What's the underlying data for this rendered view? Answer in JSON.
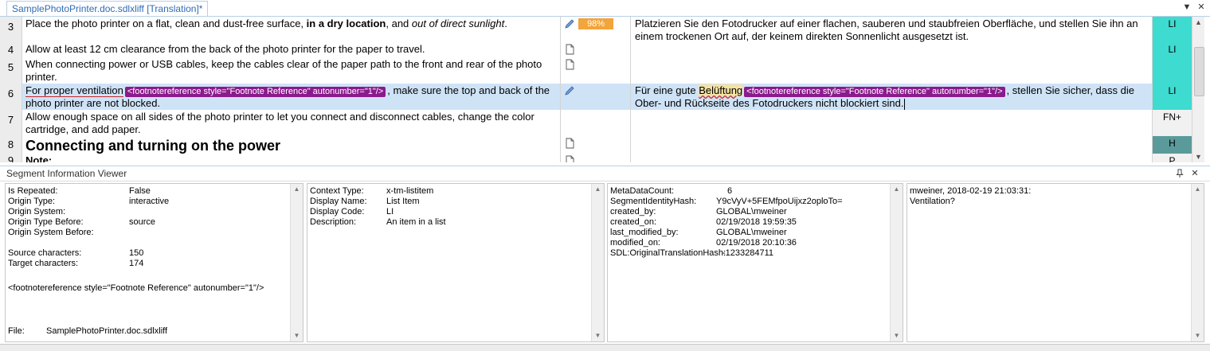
{
  "tab": {
    "title": "SamplePhotoPrinter.doc.sdlxliff [Translation]*"
  },
  "window_buttons": {
    "dropdown": "▼",
    "close": "✕"
  },
  "editor": {
    "rows": [
      {
        "num": "3",
        "status": "98%",
        "style": "LI",
        "src_parts": [
          "Place the photo printer on a flat, clean and dust-free surface, ",
          "in a dry location",
          ", and ",
          "out of direct sunlight",
          "."
        ],
        "tgt": "Platzieren Sie den Fotodrucker auf einer flachen, sauberen und staubfreien Oberfläche, und stellen Sie ihn an einem trockenen Ort auf, der keinem direkten Sonnenlicht ausgesetzt ist."
      },
      {
        "num": "4",
        "style": "LI",
        "src": "Allow at least 12 cm clearance from the back of the photo printer for the paper to travel.",
        "tgt": ""
      },
      {
        "num": "5",
        "style": "",
        "src": "When connecting power or USB cables, keep the cables clear of the paper path to the front and rear of the photo printer.",
        "tgt": ""
      },
      {
        "num": "6",
        "style": "LI",
        "src_a": "For proper ventilation",
        "tag": "<footnotereference style=\"Footnote Reference\" autonumber=\"1\"/>",
        "src_b": ", make sure the top and back of the photo printer are not blocked.",
        "tgt_a": "Für eine gute ",
        "tgt_hl": "Belüftung",
        "tgt_b": ", stellen Sie sicher, dass die Ober- und Rückseite des Fotodruckers nicht blockiert sind."
      },
      {
        "num": "7",
        "style": "FN+",
        "src": "Allow enough space on all sides of the photo printer to let you connect and disconnect cables, change the color cartridge, and add paper.",
        "tgt": ""
      },
      {
        "num": "8",
        "style": "H",
        "src": "Connecting and turning on the power",
        "tgt": ""
      },
      {
        "num": "9",
        "style": "P",
        "src": "Note:",
        "tgt": ""
      }
    ]
  },
  "viewer": {
    "title": "Segment Information Viewer",
    "pane1": {
      "rows": [
        {
          "k": "Is Repeated:",
          "v": "False"
        },
        {
          "k": "Origin Type:",
          "v": "interactive"
        },
        {
          "k": "Origin System:",
          "v": ""
        },
        {
          "k": "Origin Type Before:",
          "v": "source"
        },
        {
          "k": "Origin System Before:",
          "v": ""
        }
      ],
      "chars": [
        {
          "k": "Source characters:",
          "v": "150"
        },
        {
          "k": "Target characters:",
          "v": "174"
        }
      ],
      "tag_text": "<footnotereference style=\"Footnote Reference\" autonumber=\"1\"/>",
      "file_label": "File:",
      "file_value": "SamplePhotoPrinter.doc.sdlxliff"
    },
    "pane2": {
      "rows": [
        {
          "k": "Context Type:",
          "v": "x-tm-listitem"
        },
        {
          "k": "Display Name:",
          "v": "List Item"
        },
        {
          "k": "Display Code:",
          "v": "LI"
        },
        {
          "k": "Description:",
          "v": "An item in a list"
        }
      ]
    },
    "pane3": {
      "rows": [
        {
          "k": "MetaDataCount:",
          "v": "6"
        },
        {
          "k": "SegmentIdentityHash:",
          "v": "Y9cVyV+5FEMfpoUijxz2oploTo="
        },
        {
          "k": "created_by:",
          "v": "GLOBAL\\mweiner"
        },
        {
          "k": "created_on:",
          "v": "02/19/2018 19:59:35"
        },
        {
          "k": "last_modified_by:",
          "v": "GLOBAL\\mweiner"
        },
        {
          "k": "modified_on:",
          "v": "02/19/2018 20:10:36"
        },
        {
          "k": "SDL:OriginalTranslationHash:",
          "v": "-1233284711"
        }
      ]
    },
    "pane4": {
      "line1": "mweiner, 2018-02-19 21:03:31:",
      "line2": "Ventilation?"
    }
  }
}
